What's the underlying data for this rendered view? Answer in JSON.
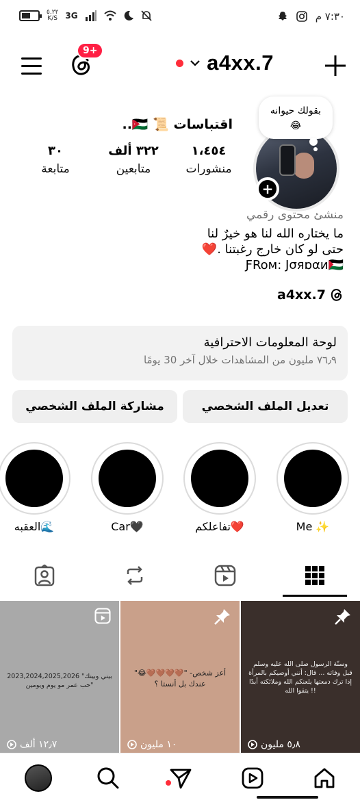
{
  "status_bar": {
    "time": "٧:٣٠ م",
    "network": "3G",
    "speed": "٥.٢٢",
    "speed_unit": "K/S",
    "battery_level": 0.55
  },
  "header": {
    "username": "a4xx.7",
    "notification_badge": "9+"
  },
  "profile": {
    "note": "بقولك حيوانه",
    "note_emoji": "😂",
    "display_name": "اقتباسات 📜 🇯🇴..",
    "stats": [
      {
        "value": "١،٤٥٤",
        "label": "منشورات"
      },
      {
        "value": "٣٢٢ ألف",
        "label": "متابعين"
      },
      {
        "value": "٣٠",
        "label": "متابعة"
      }
    ],
    "category": "منشئ محتوى رقمي",
    "bio_lines": [
      "ما يختاره الله لنا هو خيرٌ لنا",
      "حتى لو كان خارج رغبتنا .❤️",
      "ƑRoм: Jσяɒαи🇵🇸"
    ],
    "threads_handle": "a4xx.7"
  },
  "dashboard": {
    "title": "لوحة المعلومات الاحترافية",
    "subtitle": "٧٦٫٩ مليون من المشاهدات خلال آخر 30 يومًا"
  },
  "buttons": {
    "edit_profile": "تعديل الملف الشخصي",
    "share_profile": "مشاركة الملف الشخصي"
  },
  "highlights": [
    {
      "label": "Me ✨"
    },
    {
      "label": "تفاعلكم❤️"
    },
    {
      "label": "Car🖤"
    },
    {
      "label": "العقبه🌊"
    }
  ],
  "grid": [
    {
      "text": "وسنّة الرسول صلى الله عليه وسلم قبل وفاته ... قال: أنني أوصيكم بالمرأة إذا ترك دمعتها يلعنكم الله وملائكته أبدًا يتقوا الله !!",
      "views": "٥٫٨ مليون",
      "bg": "#3a2f2b",
      "pinned": true
    },
    {
      "text": "\"😂🤎🤎🤎🤎\" -أعز شخص عندك بل أنستا ؟",
      "views": "١٠ مليون",
      "bg": "#c9a08a",
      "pinned": true
    },
    {
      "text": "2023,2024,2025,2026 \"بيني وبينك حب عمر مو يوم ويومين\"",
      "views": "١٢٫٧ ألف",
      "bg": "#a9a9a9",
      "pinned": false
    }
  ],
  "colors": {
    "accent_red": "#ff2d3a",
    "badge_red": "#ff1f44",
    "muted_text": "#737373",
    "button_bg": "#efefef"
  }
}
